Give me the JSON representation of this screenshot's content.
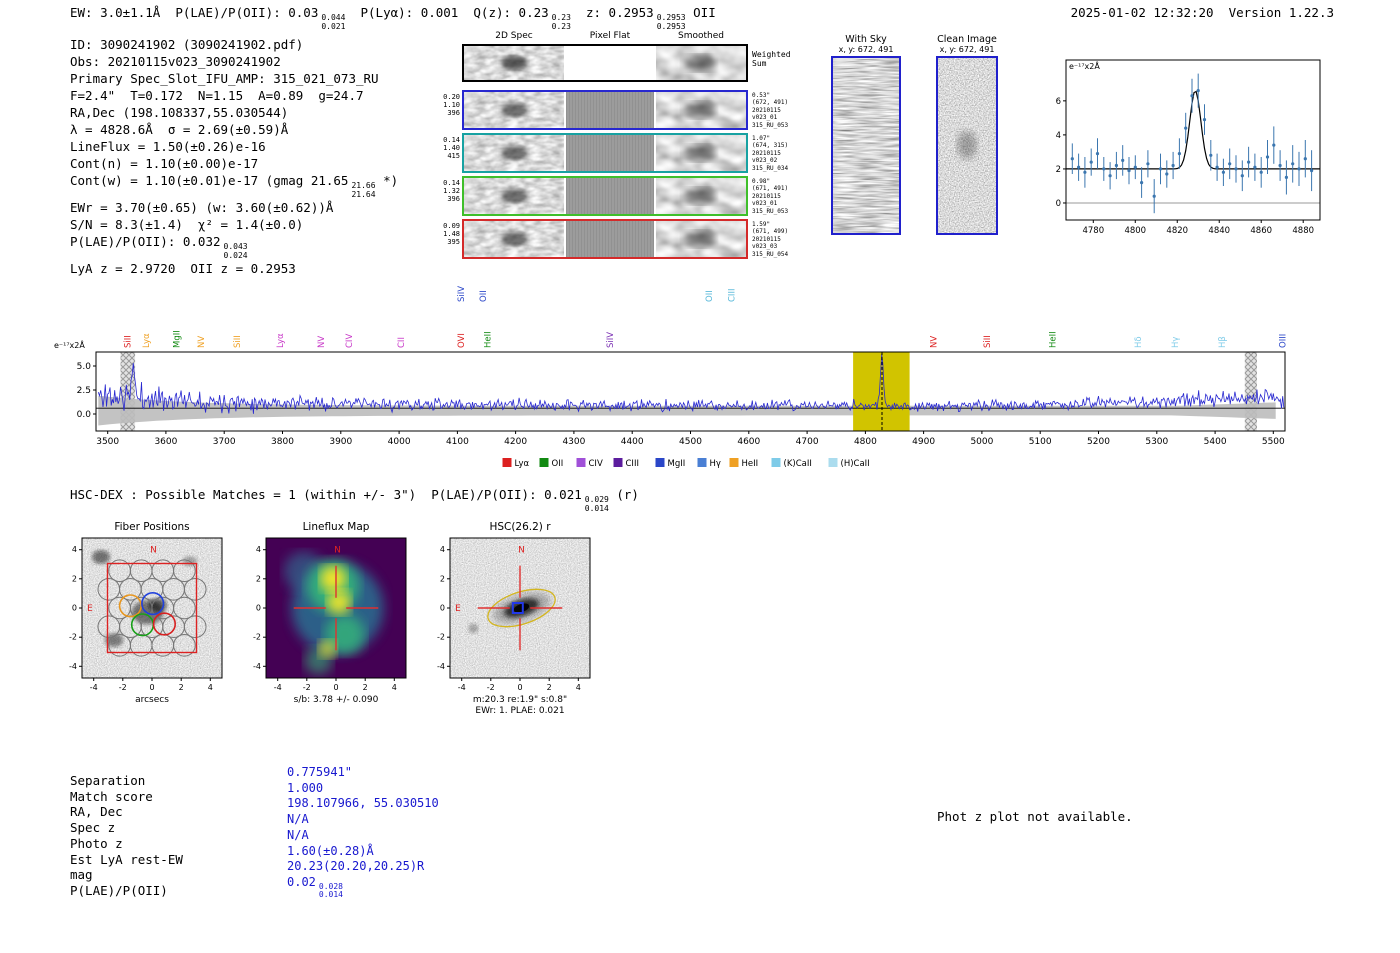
{
  "timestamp": "2025-01-02 12:32:20",
  "version": "Version 1.22.3",
  "header_segments": [
    {
      "text": "EW: 3.0±1.1Å  P(LAE)/P(OII): 0.03"
    },
    {
      "stack": [
        "0.044",
        "0.021"
      ]
    },
    {
      "text": "  P(Lyα): 0.001  Q(z): 0.23"
    },
    {
      "stack": [
        "0.23",
        "0.23"
      ]
    },
    {
      "text": "  z: 0.2953"
    },
    {
      "stack": [
        "0.2953",
        "0.2953"
      ]
    },
    {
      "text": " OII"
    }
  ],
  "info_lines": [
    [
      {
        "text": "ID: 3090241902 (3090241902.pdf)"
      }
    ],
    [
      {
        "text": "Obs: 20210115v023_3090241902"
      }
    ],
    [
      {
        "text": "Primary Spec_Slot_IFU_AMP: 315_021_073_RU"
      }
    ],
    [
      {
        "text": "F=2.4\"  T=0.172  N=1.15  A=0.89  g=24.7"
      }
    ],
    [
      {
        "text": "RA,Dec (198.108337,55.030544)"
      }
    ],
    [
      {
        "text": "λ = 4828.6Å  σ = 2.69(±0.59)Å"
      }
    ],
    [
      {
        "text": "LineFlux = 1.50(±0.26)e-16"
      }
    ],
    [
      {
        "text": "Cont(n) = 1.10(±0.00)e-17"
      }
    ],
    [
      {
        "text": "Cont(w) = 1.10(±0.01)e-17 (gmag 21.65"
      },
      {
        "stack": [
          "21.66",
          "21.64"
        ]
      },
      {
        "text": " *)"
      }
    ],
    [
      {
        "text": "EWr = 3.70(±0.65) (w: 3.60(±0.62))Å"
      }
    ],
    [
      {
        "text": "S/N = 8.3(±1.4)  χ² = 1.4(±0.0)"
      }
    ],
    [
      {
        "text": "P(LAE)/P(OII): 0.032"
      },
      {
        "stack": [
          "0.043",
          "0.024"
        ]
      }
    ],
    [
      {
        "text": "LyA z = 2.9720  OII z = 0.2953"
      }
    ]
  ],
  "spec2d": {
    "col_headers": [
      "2D Spec",
      "Pixel Flat",
      "Smoothed"
    ],
    "rows": [
      {
        "border": "#000000",
        "left": [],
        "right": [
          "Weighted",
          "Sum"
        ]
      },
      {
        "border": "#2727cf",
        "left": [
          "0.20",
          "1.10",
          "396"
        ],
        "right": [
          "0.53\"",
          "(672, 491)",
          "20210115",
          "v023_01",
          "315_RU_053"
        ]
      },
      {
        "border": "#17a2a2",
        "left": [
          "0.14",
          "1.40",
          "415"
        ],
        "right": [
          "1.07\"",
          "(674, 315)",
          "20210115",
          "v023_02",
          "315_RU_034"
        ]
      },
      {
        "border": "#3fbf2a",
        "left": [
          "0.14",
          "1.32",
          "396"
        ],
        "right": [
          "0.98\"",
          "(671, 491)",
          "20210115",
          "v023_01",
          "315_RU_053"
        ]
      },
      {
        "border": "#d42a2a",
        "left": [
          "0.09",
          "1.48",
          "395"
        ],
        "right": [
          "1.59\"",
          "(671, 499)",
          "20210115",
          "v023_03",
          "315_RU_054"
        ]
      }
    ]
  },
  "sky_panel": {
    "title": "With Sky",
    "subtitle": "x, y: 672, 491"
  },
  "clean_panel": {
    "title": "Clean Image",
    "subtitle": "x, y: 672, 491"
  },
  "hsc_header_segments": [
    {
      "text": "HSC-DEX : Possible Matches = 1 (within +/- 3\")  P(LAE)/P(OII): 0.021"
    },
    {
      "stack": [
        "0.029",
        "0.014"
      ]
    },
    {
      "text": " (r)"
    }
  ],
  "cutouts": [
    {
      "title": "Fiber Positions",
      "xlabel": "arcsecs",
      "xlabel2": "",
      "xticks": [
        "-4",
        "-2",
        "0",
        "2",
        "4"
      ],
      "yticks": [
        "4",
        "2",
        "0",
        "-2",
        "-4"
      ],
      "north": "N",
      "east": "E"
    },
    {
      "title": "Lineflux Map",
      "xlabel": "s/b: 3.78 +/- 0.090",
      "xlabel2": "",
      "xticks": [
        "-4",
        "-2",
        "0",
        "2",
        "4"
      ],
      "yticks": [
        "4",
        "2",
        "0",
        "-2",
        "-4"
      ],
      "north": "N",
      "east": ""
    },
    {
      "title": "HSC(26.2) r",
      "xlabel": "m:20.3 re:1.9\" s:0.8\"",
      "xlabel2": "EWr: 1. PLAE: 0.021",
      "xticks": [
        "-4",
        "-2",
        "0",
        "2",
        "4"
      ],
      "yticks": [
        "4",
        "2",
        "0",
        "-2",
        "-4"
      ],
      "north": "N",
      "east": "E"
    }
  ],
  "match_table": [
    {
      "label": "Separation",
      "value": "0.775941\""
    },
    {
      "label": "Match score",
      "value": "1.000"
    },
    {
      "label": "RA, Dec",
      "value": "198.107966, 55.030510"
    },
    {
      "label": "Spec z",
      "value": "N/A"
    },
    {
      "label": "Photo z",
      "value": "N/A"
    },
    {
      "label": "Est LyA rest-EW",
      "value": "1.60(±0.28)Å"
    },
    {
      "label": "mag",
      "value": "20.23(20.20,20.25)R"
    },
    {
      "label": "P(LAE)/P(OII)",
      "value": "0.02",
      "stack": [
        "0.028",
        "0.014"
      ]
    }
  ],
  "footer_note": "Phot z plot not available.",
  "chart_data": [
    {
      "id": "line_fit",
      "type": "scatter",
      "title": "",
      "ylabel": "e-17 x2Å",
      "ylabel_display": "e⁻¹⁷x2Å",
      "xlim": [
        4767,
        4888
      ],
      "ylim": [
        -1.0,
        8.4
      ],
      "xticks": [
        4780,
        4800,
        4820,
        4840,
        4860,
        4880
      ],
      "yticks": [
        0,
        2,
        4,
        6
      ],
      "continuum": 2.0,
      "fit_gaussian": {
        "center": 4828.6,
        "sigma": 2.69,
        "amplitude": 4.6
      },
      "marker_color": "#3b76af",
      "fit_color": "#000000",
      "points": {
        "x": [
          4770,
          4773,
          4776,
          4779,
          4782,
          4785,
          4788,
          4791,
          4794,
          4797,
          4800,
          4803,
          4806,
          4809,
          4812,
          4815,
          4818,
          4821,
          4824,
          4827,
          4830,
          4833,
          4836,
          4839,
          4842,
          4845,
          4848,
          4851,
          4854,
          4857,
          4860,
          4863,
          4866,
          4869,
          4872,
          4875,
          4878,
          4881,
          4884
        ],
        "y": [
          2.6,
          2.1,
          1.8,
          2.4,
          2.9,
          2.0,
          1.6,
          2.2,
          2.5,
          1.9,
          2.1,
          1.2,
          2.3,
          0.4,
          2.0,
          1.7,
          2.2,
          2.9,
          4.4,
          6.3,
          6.6,
          4.9,
          2.8,
          2.1,
          1.8,
          2.3,
          2.0,
          1.6,
          2.4,
          2.1,
          1.8,
          2.7,
          3.4,
          2.2,
          1.5,
          2.3,
          2.0,
          2.6,
          1.9
        ],
        "yerr": [
          0.9,
          0.8,
          0.9,
          0.8,
          0.9,
          0.7,
          0.8,
          0.8,
          0.9,
          0.8,
          0.7,
          0.9,
          0.8,
          1.0,
          0.9,
          0.8,
          0.8,
          0.9,
          0.9,
          1.0,
          1.0,
          0.9,
          0.9,
          0.8,
          0.8,
          0.9,
          0.8,
          0.9,
          0.9,
          0.8,
          0.9,
          1.0,
          1.1,
          0.9,
          1.0,
          1.1,
          1.0,
          1.1,
          1.2
        ]
      }
    },
    {
      "id": "full_spectrum",
      "type": "line",
      "ylabel": "e-17 x2Å",
      "ylabel_display": "e⁻¹⁷x2Å",
      "xlim": [
        3480,
        5520
      ],
      "ylim": [
        -1.77,
        6.46
      ],
      "xticks": [
        3500,
        3600,
        3700,
        3800,
        3900,
        4000,
        4100,
        4200,
        4300,
        4400,
        4500,
        4600,
        4700,
        4800,
        4900,
        5000,
        5100,
        5200,
        5300,
        5400,
        5500
      ],
      "yticks": [
        0.0,
        2.5,
        5.0
      ],
      "line_color": "#2828d0",
      "noise_envelope_color": "#bdbdbd",
      "continuum_median": 1.1,
      "emission_line": {
        "center": 4828.6,
        "sigma": 2.69,
        "peak": 5.2
      },
      "highlight_band": {
        "x0": 4779,
        "x1": 4876,
        "color": "#d1c400"
      },
      "masked_bands": [
        [
          3522,
          3547
        ],
        [
          5451,
          5472
        ]
      ],
      "generator": {
        "seed": 11,
        "note": "noisy spectrum texture regenerated from these parameters; continuum ~1.1e-17, noise sigma ~0.5 rising at blue end, detected line at 4828.6Å peaking ~6"
      },
      "legend": [
        {
          "label": "Lyα",
          "color": "#dc2020"
        },
        {
          "label": "OII",
          "color": "#128a12"
        },
        {
          "label": "CIV",
          "color": "#a050d8"
        },
        {
          "label": "CIII",
          "color": "#5c1d9e"
        },
        {
          "label": "MgII",
          "color": "#2a46c8"
        },
        {
          "label": "Hγ",
          "color": "#4a7fd4"
        },
        {
          "label": "HeII",
          "color": "#efa023"
        },
        {
          "label": "(K)CaII",
          "color": "#7ecbe8"
        },
        {
          "label": "(H)CaII",
          "color": "#abdcee"
        }
      ],
      "line_markers": [
        {
          "label": "SiII",
          "wave": 3534,
          "color": "#dc2020",
          "tier": 0
        },
        {
          "label": "Lyα",
          "wave": 3566,
          "color": "#efa023",
          "tier": 0
        },
        {
          "label": "MgII",
          "wave": 3618,
          "color": "#128a12",
          "tier": 0
        },
        {
          "label": "NV",
          "wave": 3660,
          "color": "#efa023",
          "tier": 0
        },
        {
          "label": "SiII",
          "wave": 3722,
          "color": "#efa023",
          "tier": 0
        },
        {
          "label": "Lyα",
          "wave": 3796,
          "color": "#c838c8",
          "tier": 0
        },
        {
          "label": "NV",
          "wave": 3866,
          "color": "#c838c8",
          "tier": 0
        },
        {
          "label": "CIV",
          "wave": 3914,
          "color": "#c838c8",
          "tier": 0
        },
        {
          "label": "CII",
          "wave": 4003,
          "color": "#c838c8",
          "tier": 0
        },
        {
          "label": "OVI",
          "wave": 4106,
          "color": "#dc2020",
          "tier": 0
        },
        {
          "label": "SiIV",
          "wave": 4106,
          "color": "#2a46c8",
          "tier": 1
        },
        {
          "label": "OII",
          "wave": 4144,
          "color": "#2a46c8",
          "tier": 1
        },
        {
          "label": "HeII",
          "wave": 4152,
          "color": "#128a12",
          "tier": 0
        },
        {
          "label": "SiIV",
          "wave": 4362,
          "color": "#7a2fb4",
          "tier": 0
        },
        {
          "label": "OII",
          "wave": 4532,
          "color": "#57b8d9",
          "tier": 1
        },
        {
          "label": "CIII",
          "wave": 4570,
          "color": "#57b8d9",
          "tier": 1
        },
        {
          "label": "NV",
          "wave": 4917,
          "color": "#dc2020",
          "tier": 0
        },
        {
          "label": "SiII",
          "wave": 5009,
          "color": "#dc2020",
          "tier": 0
        },
        {
          "label": "HeII",
          "wave": 5121,
          "color": "#128a12",
          "tier": 0
        },
        {
          "label": "Hδ",
          "wave": 5268,
          "color": "#7ecbe8",
          "tier": 0
        },
        {
          "label": "Hγ",
          "wave": 5331,
          "color": "#7ecbe8",
          "tier": 0
        },
        {
          "label": "Hβ",
          "wave": 5412,
          "color": "#7ecbe8",
          "tier": 0
        },
        {
          "label": "OIII",
          "wave": 5516,
          "color": "#2a46c8",
          "tier": 0
        }
      ]
    }
  ]
}
